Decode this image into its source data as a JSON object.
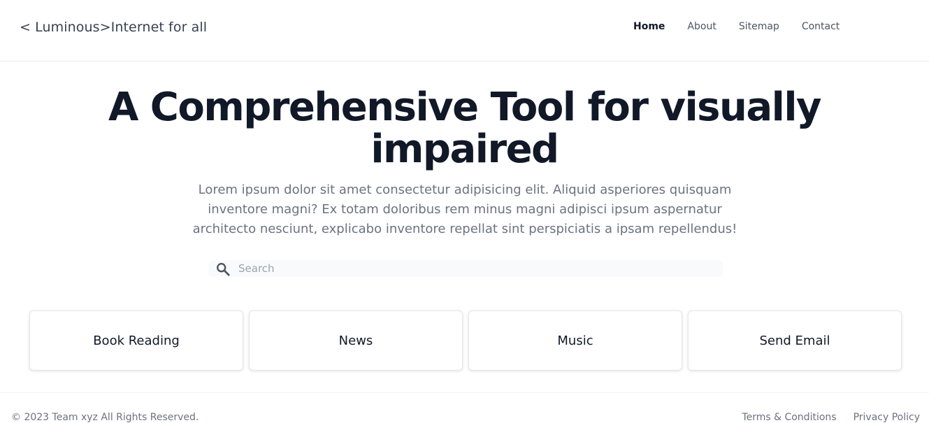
{
  "header": {
    "brand": "< Luminous>Internet for all",
    "nav": [
      {
        "label": "Home",
        "active": true
      },
      {
        "label": "About",
        "active": false
      },
      {
        "label": "Sitemap",
        "active": false
      },
      {
        "label": "Contact",
        "active": false
      }
    ]
  },
  "hero": {
    "title_line1": "A Comprehensive Tool for visually",
    "title_line2": "impaired",
    "description": "Lorem ipsum dolor sit amet consectetur adipisicing elit. Aliquid asperiores quisquam inventore magni? Ex totam doloribus rem minus magni adipisci ipsum aspernatur architecto nesciunt, explicabo inventore repellat sint perspiciatis a ipsam repellendus!"
  },
  "search": {
    "placeholder": "Search",
    "value": "",
    "icon": "search-icon"
  },
  "cards": [
    {
      "label": "Book Reading"
    },
    {
      "label": "News"
    },
    {
      "label": "Music"
    },
    {
      "label": "Send Email"
    }
  ],
  "footer": {
    "copyright": "© 2023 Team xyz All Rights Reserved.",
    "links": [
      {
        "label": "Terms & Conditions"
      },
      {
        "label": "Privacy Policy"
      }
    ]
  },
  "colors": {
    "title": "#111827",
    "body_text": "#6b7280",
    "border": "#e5e7eb",
    "search_bg": "#f9fafb"
  }
}
